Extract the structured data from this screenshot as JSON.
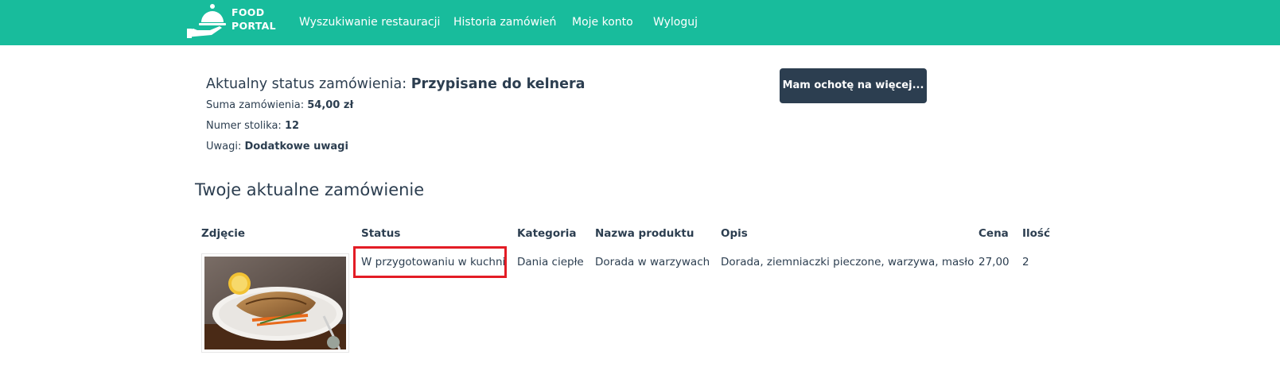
{
  "logo": {
    "line1": "FOOD",
    "line2": "PORTAL"
  },
  "nav": {
    "items": [
      {
        "label": "Wyszukiwanie restauracji"
      },
      {
        "label": "Historia zamówień"
      },
      {
        "label": "Moje konto"
      },
      {
        "label": "Wyloguj"
      }
    ]
  },
  "order": {
    "status_label": "Aktualny status zamówienia: ",
    "status_value": "Przypisane do kelnera",
    "sum_label": "Suma zamówienia: ",
    "sum_value": "54,00 zł",
    "table_label": "Numer stolika: ",
    "table_value": "12",
    "notes_label": "Uwagi: ",
    "notes_value": "Dodatkowe uwagi"
  },
  "more_button": {
    "label": "Mam ochotę na więcej..."
  },
  "section_title": "Twoje aktualne zamówienie",
  "table": {
    "headers": [
      "Zdjęcie",
      "Status",
      "Kategoria",
      "Nazwa produktu",
      "Opis",
      "Cena",
      "Ilość"
    ],
    "rows": [
      {
        "status": "W przygotowaniu w kuchni",
        "category": "Dania ciepłe",
        "product_name": "Dorada w warzywach",
        "description": "Dorada, ziemniaczki pieczone, warzywa, masło",
        "price": "27,00",
        "quantity": "2"
      }
    ]
  },
  "colors": {
    "navbar": "#18bc9c",
    "primary_dark": "#2c3e50",
    "highlight": "#e31c25"
  }
}
